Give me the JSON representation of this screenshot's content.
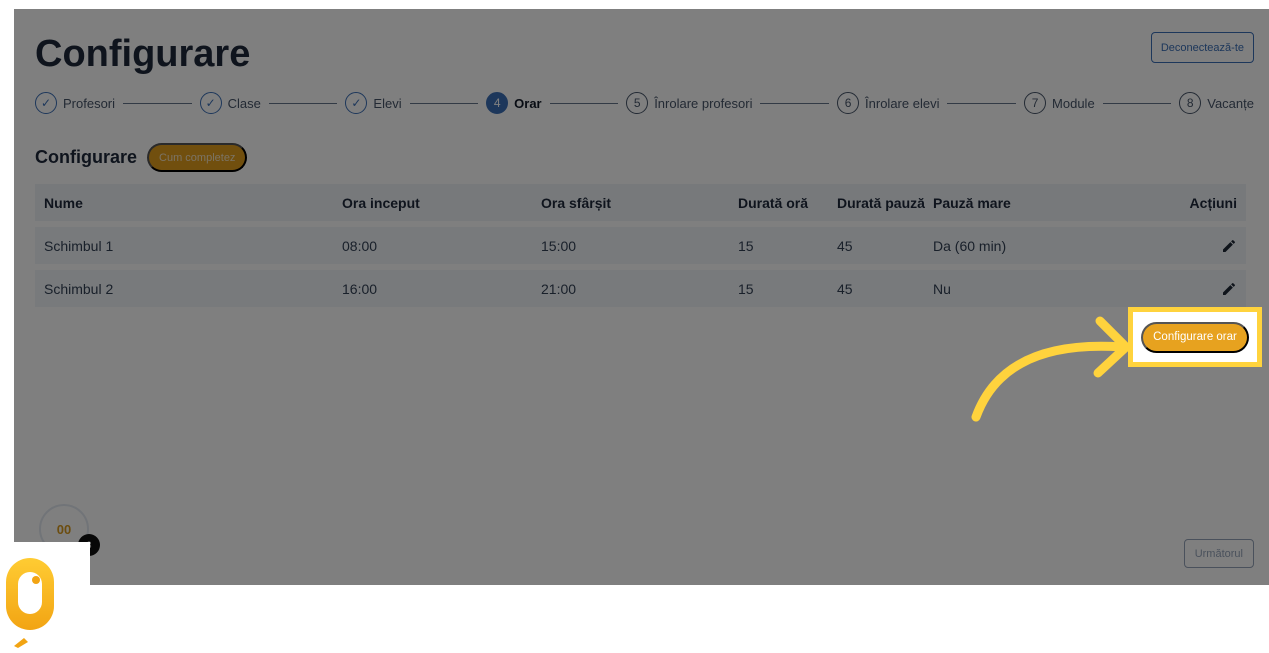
{
  "header": {
    "title": "Configurare",
    "logout_label": "Deconectează-te"
  },
  "stepper": {
    "steps": [
      {
        "number": "",
        "label": "Profesori",
        "state": "done"
      },
      {
        "number": "",
        "label": "Clase",
        "state": "done"
      },
      {
        "number": "",
        "label": "Elevi",
        "state": "done"
      },
      {
        "number": "4",
        "label": "Orar",
        "state": "active"
      },
      {
        "number": "5",
        "label": "Înrolare profesori",
        "state": "pending"
      },
      {
        "number": "6",
        "label": "Înrolare elevi",
        "state": "pending"
      },
      {
        "number": "7",
        "label": "Module",
        "state": "pending"
      },
      {
        "number": "8",
        "label": "Vacanțe",
        "state": "pending"
      }
    ]
  },
  "section": {
    "title": "Configurare",
    "help_label": "Cum completez"
  },
  "table": {
    "columns": [
      "Nume",
      "Ora inceput",
      "Ora sfârșit",
      "Durată oră",
      "Durată pauză",
      "Pauză mare",
      "Acțiuni"
    ],
    "rows": [
      [
        "Schimbul 1",
        "08:00",
        "15:00",
        "15",
        "45",
        "Da (60 min)"
      ],
      [
        "Schimbul 2",
        "16:00",
        "21:00",
        "15",
        "45",
        "Nu"
      ]
    ]
  },
  "actions": {
    "configure_label": "Configurare orar",
    "next_label": "Următorul"
  },
  "avatar": {
    "initials": "00",
    "badge": "3"
  },
  "colors": {
    "accent": "#3b6fb6",
    "cta": "#e7a21f",
    "highlight": "#ffd33d"
  }
}
